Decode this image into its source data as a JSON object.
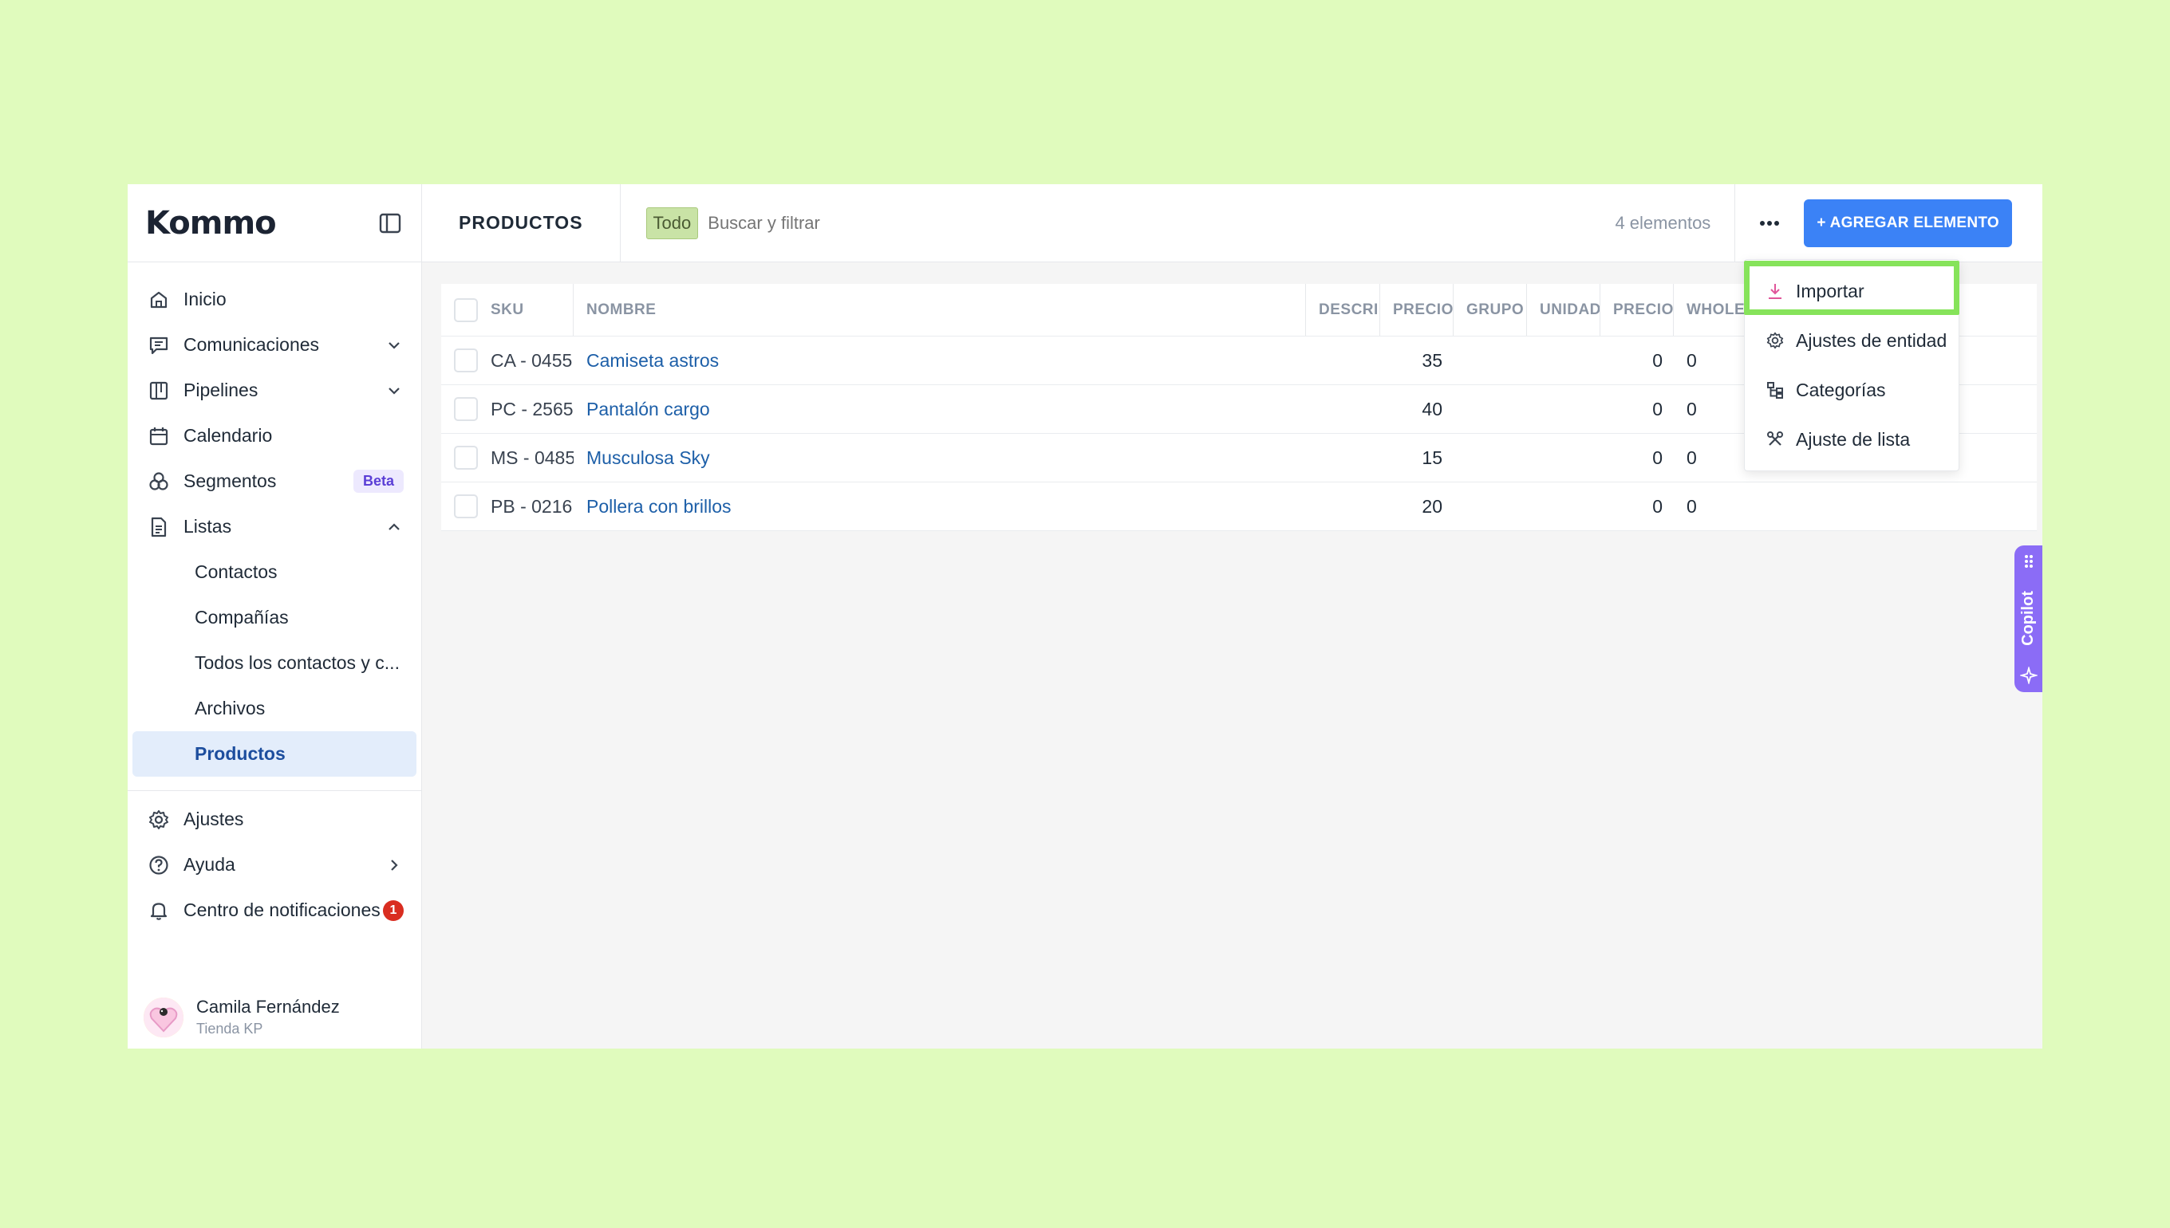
{
  "app": {
    "logo": "Kommo"
  },
  "sidebar": {
    "items": [
      {
        "label": "Inicio",
        "icon": "home-icon"
      },
      {
        "label": "Comunicaciones",
        "icon": "chat-icon",
        "expandable": true
      },
      {
        "label": "Pipelines",
        "icon": "pipeline-icon",
        "expandable": true
      },
      {
        "label": "Calendario",
        "icon": "calendar-icon"
      },
      {
        "label": "Segmentos",
        "icon": "segments-icon",
        "badge": "Beta"
      },
      {
        "label": "Listas",
        "icon": "list-icon",
        "expanded": true
      }
    ],
    "sub_items": [
      {
        "label": "Contactos"
      },
      {
        "label": "Compañías"
      },
      {
        "label": "Todos los contactos y c..."
      },
      {
        "label": "Archivos"
      },
      {
        "label": "Productos",
        "active": true
      }
    ],
    "bottom_items": [
      {
        "label": "Ajustes",
        "icon": "gear-icon"
      },
      {
        "label": "Ayuda",
        "icon": "help-icon"
      },
      {
        "label": "Centro de notificaciones",
        "icon": "bell-icon",
        "badge": "1"
      }
    ],
    "user": {
      "name": "Camila Fernández",
      "company": "Tienda KP"
    }
  },
  "header": {
    "title": "PRODUCTOS",
    "filter_tag": "Todo",
    "search_placeholder": "Buscar y filtrar",
    "count": "4 elementos",
    "more_label": "···",
    "add_button": "+ AGREGAR ELEMENTO"
  },
  "table": {
    "columns": [
      "SKU",
      "NOMBRE",
      "DESCRI",
      "PRECIO",
      "GRUPO",
      "UNIDAD",
      "PRECIO",
      "WHOLE"
    ],
    "rows": [
      {
        "sku": "CA - 0455",
        "name": "Camiseta astros",
        "price": "35",
        "price2": "0",
        "whole": "0"
      },
      {
        "sku": "PC - 2565",
        "name": "Pantalón cargo",
        "price": "40",
        "price2": "0",
        "whole": "0"
      },
      {
        "sku": "MS - 0485",
        "name": "Musculosa Sky",
        "price": "15",
        "price2": "0",
        "whole": "0"
      },
      {
        "sku": "PB - 0216",
        "name": "Pollera con brillos",
        "price": "20",
        "price2": "0",
        "whole": "0"
      }
    ]
  },
  "dropdown": {
    "items": [
      {
        "label": "Importar",
        "icon": "download-icon"
      },
      {
        "label": "Ajustes de entidad",
        "icon": "gear-icon"
      },
      {
        "label": "Categorías",
        "icon": "category-tree-icon"
      },
      {
        "label": "Ajuste de lista",
        "icon": "tools-icon"
      }
    ]
  },
  "copilot": {
    "label": "Copilot"
  },
  "colors": {
    "accent": "#3b82f6",
    "highlight": "#86e35a",
    "background": "#e0fbbd",
    "copilot": "#8b6cf6"
  }
}
